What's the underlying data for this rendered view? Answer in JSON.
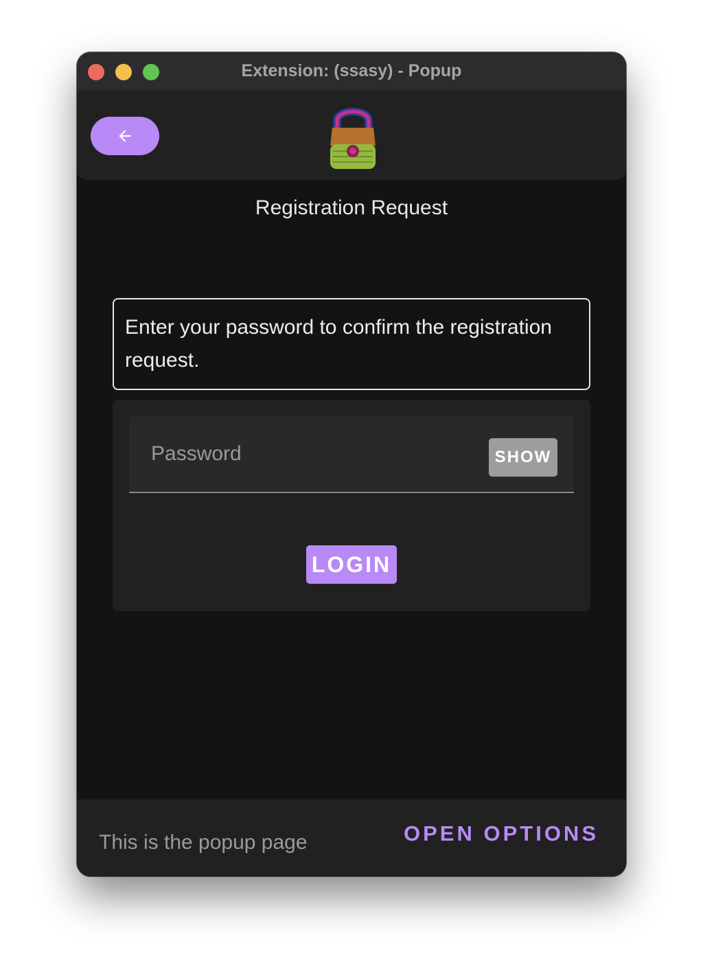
{
  "window": {
    "title": "Extension: (ssasy) - Popup"
  },
  "header": {
    "back_icon": "arrow-left-icon",
    "logo": "padlock-logo"
  },
  "main": {
    "title": "Registration Request",
    "info_text": "Enter your password to confirm the registration request.",
    "password_placeholder": "Password",
    "password_value": "",
    "show_label": "SHOW",
    "login_label": "LOGIN"
  },
  "footer": {
    "text": "This is the popup page",
    "open_options_label": "OPEN OPTIONS"
  },
  "colors": {
    "accent": "#b989f7",
    "background": "#131313",
    "surface": "#212121",
    "field": "#292929",
    "show_button": "#9d9d9d"
  }
}
